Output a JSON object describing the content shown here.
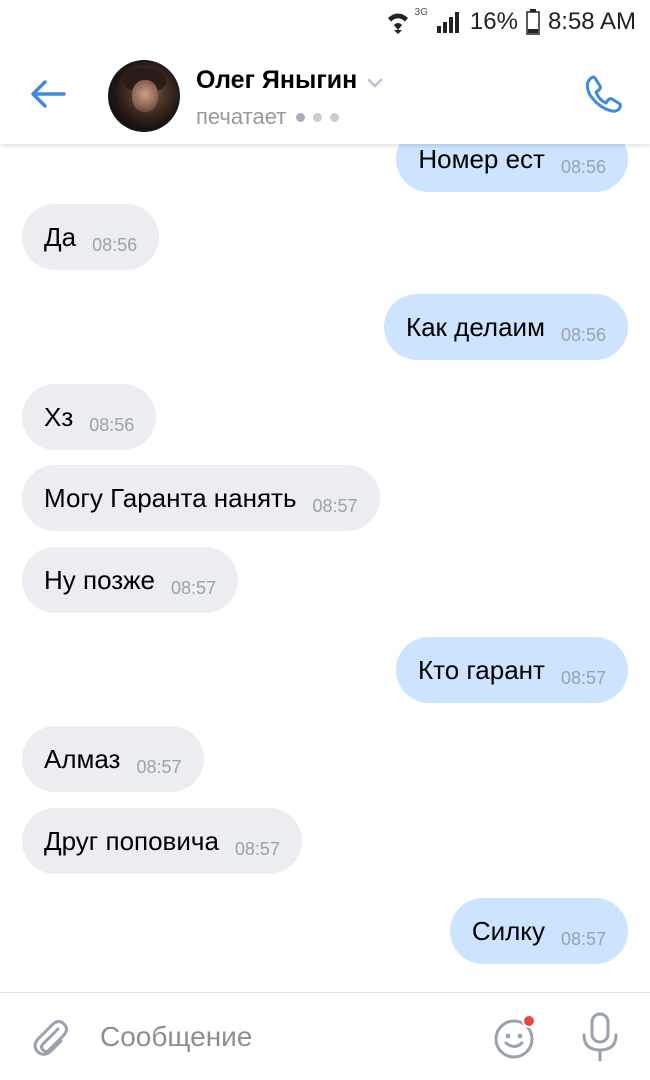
{
  "status_bar": {
    "network": "3G",
    "battery": "16%",
    "time": "8:58 AM"
  },
  "header": {
    "contact_name": "Олег Яныгин",
    "status": "печатает"
  },
  "messages": [
    {
      "dir": "out",
      "text": "Номер ест",
      "time": "08:56"
    },
    {
      "dir": "in",
      "text": "Да",
      "time": "08:56"
    },
    {
      "dir": "out",
      "text": "Как делаим",
      "time": "08:56"
    },
    {
      "dir": "in",
      "text": "Хз",
      "time": "08:56"
    },
    {
      "dir": "in",
      "text": "Могу Гаранта нанять",
      "time": "08:57"
    },
    {
      "dir": "in",
      "text": "Ну позже",
      "time": "08:57"
    },
    {
      "dir": "out",
      "text": "Кто гарант",
      "time": "08:57"
    },
    {
      "dir": "in",
      "text": "Алмаз",
      "time": "08:57"
    },
    {
      "dir": "in",
      "text": "Друг поповича",
      "time": "08:57"
    },
    {
      "dir": "out",
      "text": "Силку",
      "time": "08:57"
    }
  ],
  "composer": {
    "placeholder": "Сообщение"
  },
  "colors": {
    "accent": "#3f8ae0",
    "incoming_bubble": "#ebedf0",
    "outgoing_bubble": "#cce4ff",
    "notification_dot": "#e64646"
  }
}
